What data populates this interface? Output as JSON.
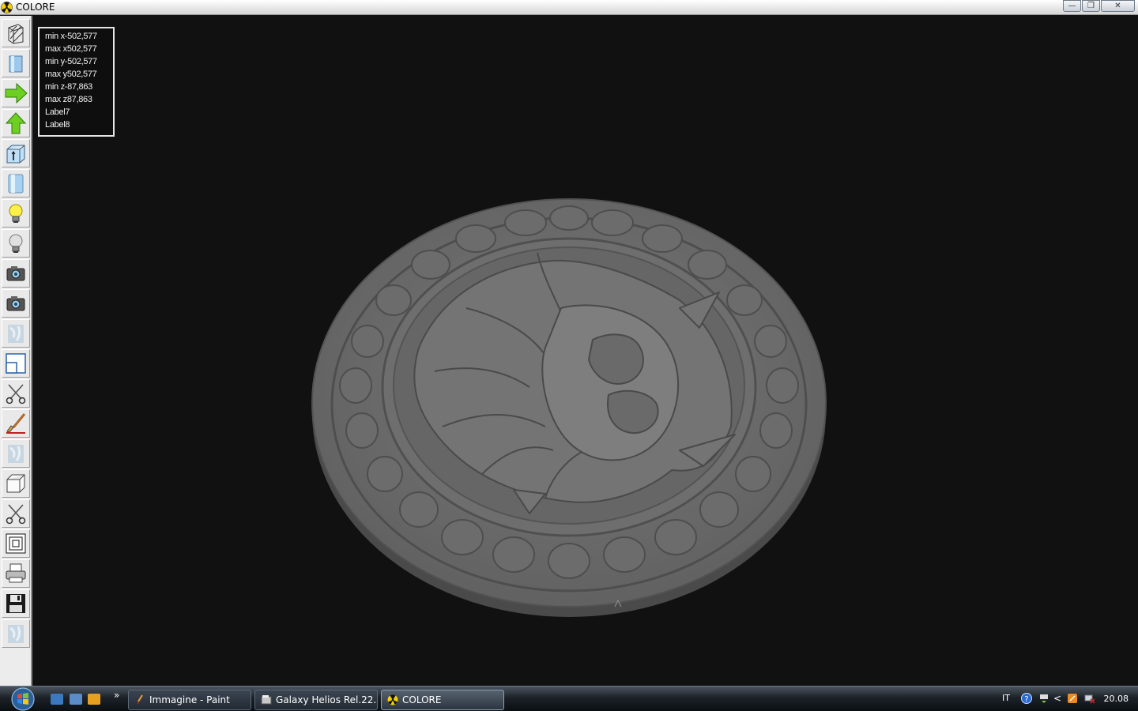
{
  "window": {
    "title": "COLORE",
    "minimize": "—",
    "maximize": "❐",
    "close": "✕"
  },
  "toolbar": {
    "buttons": [
      "wireframe-icon",
      "shaded-box-icon",
      "arrow-right-icon",
      "arrow-up-icon",
      "box-info-icon",
      "cylinder-icon",
      "light-on-icon",
      "light-off-icon",
      "camera-icon",
      "camera-alt-icon",
      "texture-icon",
      "window-split-icon",
      "scissors-icon",
      "brush-icon",
      "texture-alt-icon",
      "cube-icon",
      "scissors-alt-icon",
      "concentric-squares-icon",
      "printer-icon",
      "save-disk-icon",
      "texture-disabled-icon"
    ]
  },
  "info": {
    "min_x": "min x-502,577",
    "max_x": "max x502,577",
    "min_y": "min y-502,577",
    "max_y": "max y502,577",
    "min_z": "min z-87,863",
    "max_z": "max z87,863",
    "label7": "Label7",
    "label8": "Label8"
  },
  "taskbar": {
    "more": "»",
    "items": [
      {
        "label": "Immagine - Paint"
      },
      {
        "label": "Galaxy Helios  Rel.22..."
      },
      {
        "label": "COLORE"
      }
    ],
    "tray": {
      "lang": "IT",
      "chevron": "<",
      "clock": "20.08"
    }
  }
}
